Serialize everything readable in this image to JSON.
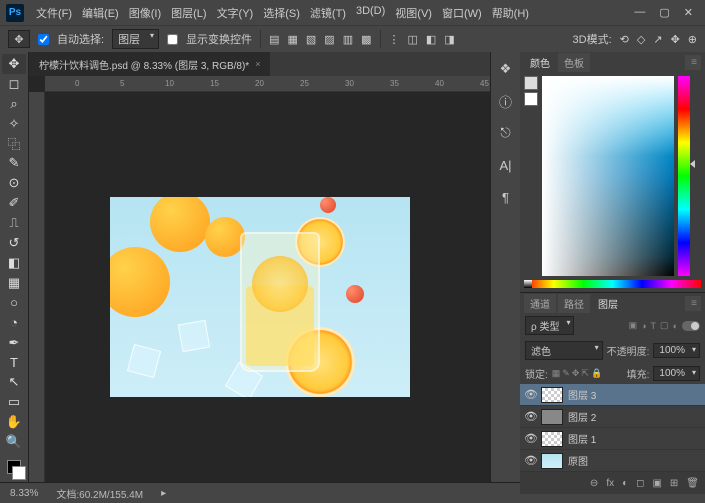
{
  "app": {
    "logo": "Ps"
  },
  "menu": [
    "文件(F)",
    "编辑(E)",
    "图像(I)",
    "图层(L)",
    "文字(Y)",
    "选择(S)",
    "滤镜(T)",
    "3D(D)",
    "视图(V)",
    "窗口(W)",
    "帮助(H)"
  ],
  "window_controls": {
    "min": "—",
    "max": "▢",
    "close": "✕"
  },
  "options": {
    "move_icon": "✥",
    "auto_select_label": "自动选择:",
    "auto_select_value": "图层",
    "transform_controls_label": "显示变换控件",
    "align_icons": [
      "▤",
      "▦",
      "▧",
      "▨",
      "▥",
      "▩",
      "⋮",
      "◫",
      "◧",
      "◨"
    ],
    "mode_label": "3D模式:",
    "mode_icons": [
      "⟲",
      "◇",
      "↗",
      "✥",
      "⊕"
    ]
  },
  "document": {
    "tab_title": "柠檬汁饮料调色.psd @ 8.33% (图层 3, RGB/8)*",
    "tab_close": "×"
  },
  "ruler_ticks": [
    "0",
    "5",
    "10",
    "15",
    "20",
    "25",
    "30",
    "35",
    "40",
    "45"
  ],
  "collapsed_panels": [
    "❖",
    "ⓘ",
    "⎋",
    "A|",
    "¶"
  ],
  "color_panel": {
    "tabs": [
      "颜色",
      "色板"
    ],
    "menu": "≡"
  },
  "layers_panel": {
    "tabs": [
      "通道",
      "路径",
      "图层"
    ],
    "kind_label": "ρ 类型",
    "filter_icons": [
      "▣",
      "◑",
      "T",
      "▢",
      "◐"
    ],
    "blend_mode": "滤色",
    "opacity_label": "不透明度:",
    "opacity_value": "100%",
    "lock_label": "锁定:",
    "lock_icons": [
      "▦",
      "✎",
      "✥",
      "⇱",
      "🔒"
    ],
    "fill_label": "填充:",
    "fill_value": "100%",
    "layers": [
      {
        "name": "图层 3",
        "visible": true,
        "thumb": "checker",
        "selected": true
      },
      {
        "name": "图层 2",
        "visible": true,
        "thumb": "solid",
        "selected": false
      },
      {
        "name": "图层 1",
        "visible": true,
        "thumb": "checker",
        "selected": false
      },
      {
        "name": "原图",
        "visible": true,
        "thumb": "img",
        "selected": false
      }
    ],
    "bottom_icons": [
      "⊖",
      "fx",
      "◐",
      "◻",
      "▣",
      "⊞",
      "🗑"
    ]
  },
  "status": {
    "zoom": "8.33%",
    "docinfo": "文档:60.2M/155.4M",
    "arrow": "▸"
  }
}
